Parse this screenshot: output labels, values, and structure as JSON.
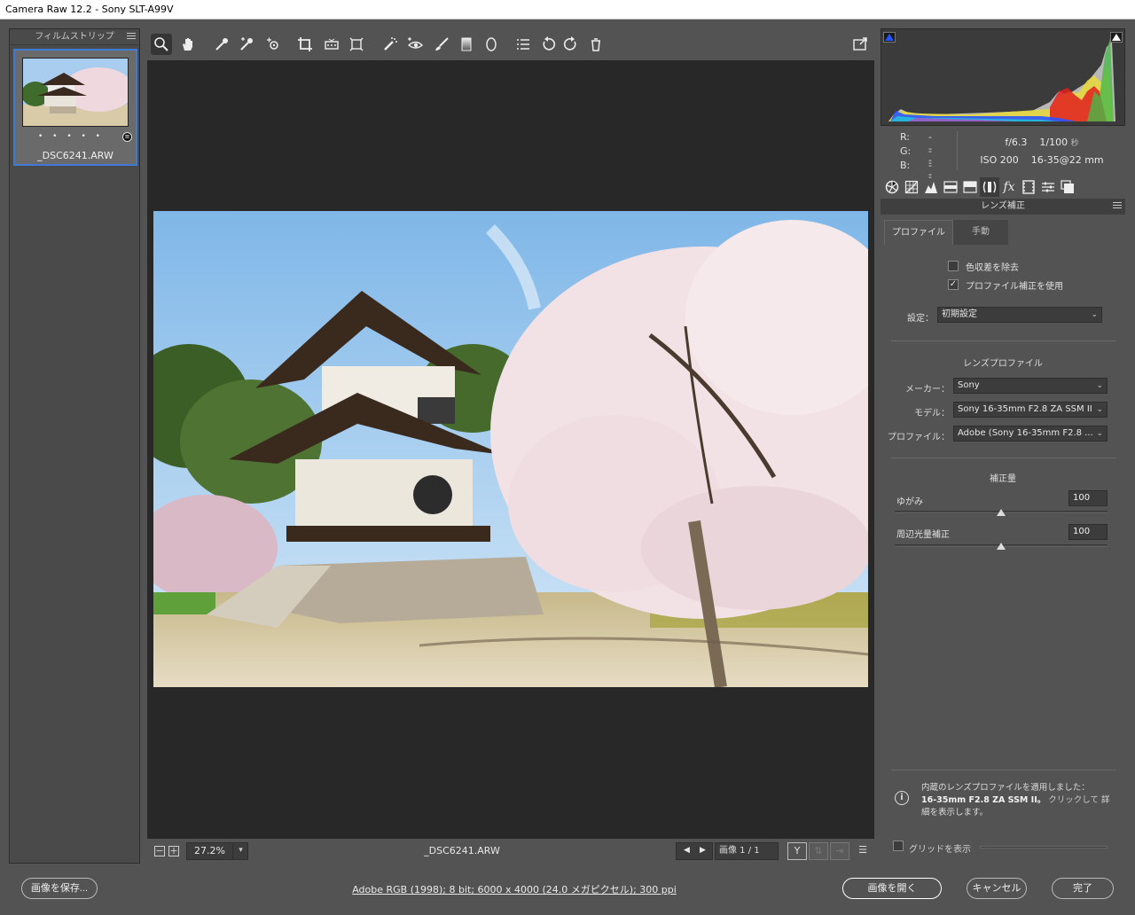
{
  "window": {
    "title": "Camera Raw 12.2  -  Sony SLT-A99V"
  },
  "filmstrip": {
    "header": "フィルムストリップ",
    "thumbnail": {
      "filename": "_DSC6241.ARW",
      "rating": "• • • • •"
    }
  },
  "toolbar": {
    "tools": [
      "zoom-icon",
      "hand-icon",
      "white-balance-icon",
      "color-sampler-icon",
      "targeted-adjust-icon",
      "crop-icon",
      "straighten-icon",
      "transform-icon",
      "spot-removal-icon",
      "redeye-icon",
      "brush-icon",
      "graduated-filter-icon",
      "radial-filter-icon",
      "preferences-list-icon",
      "rotate-left-icon",
      "rotate-right-icon",
      "trash-icon"
    ],
    "fullscreen_icon": "fullscreen-icon"
  },
  "statusbar": {
    "zoom_value": "27.2%",
    "filename": "_DSC6241.ARW",
    "image_count": "画像 1 / 1",
    "y_label": "Y"
  },
  "info": {
    "r_label": "R:",
    "g_label": "G:",
    "b_label": "B:",
    "r_value": "---",
    "g_value": "---",
    "b_value": "---",
    "aperture": "f/6.3",
    "shutter": "1/100",
    "shutter_unit": "秒",
    "iso": "ISO 200",
    "lens": "16-35@22 mm"
  },
  "panel": {
    "section_title": "レンズ補正",
    "tabs": {
      "profile": "プロファイル",
      "manual": "手動"
    },
    "remove_ca": {
      "label": "色収差を除去",
      "checked": false
    },
    "enable_profile": {
      "label": "プロファイル補正を使用",
      "checked": true,
      "mark": "✓"
    },
    "setup_label": "設定：",
    "setup_value": "初期設定",
    "lens_profile_heading": "レンズプロファイル",
    "make_label": "メーカー：",
    "make_value": "Sony",
    "model_label": "モデル：",
    "model_value": "Sony 16-35mm F2.8 ZA SSM II",
    "profile_label": "プロファイル：",
    "profile_value": "Adobe (Sony 16-35mm F2.8 ...",
    "amount_heading": "補正量",
    "distortion_label": "ゆがみ",
    "distortion_value": "100",
    "vignetting_label": "周辺光量補正",
    "vignetting_value": "100",
    "notice_line1": "内蔵のレンズプロファイルを適用しました：",
    "notice_lens": "16-35mm F2.8 ZA SSM II。",
    "notice_link": "クリックして",
    "notice_detail": "詳細を表示します。",
    "grid_label": "グリッドを表示"
  },
  "slider_levels": {
    "distortion": 0.5,
    "vignetting": 0.5
  },
  "footer": {
    "save_button": "画像を保存...",
    "workflow": "Adobe RGB (1998); 8 bit; 6000 x 4000 (24.0 メガピクセル); 300 ppi",
    "open_button": "画像を開く",
    "cancel_button": "キャンセル",
    "done_button": "完了"
  },
  "colors": {
    "accent": "#3d7bd4",
    "canvas": "#282828",
    "panel": "#535353"
  }
}
